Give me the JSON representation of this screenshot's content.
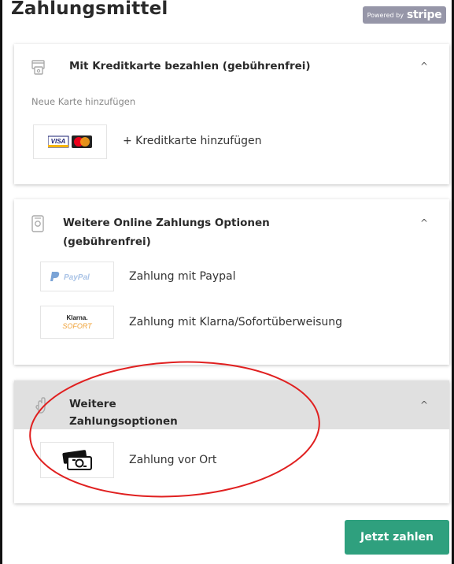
{
  "header": {
    "title": "Zahlungsmittel",
    "badge_powered": "Powered by",
    "badge_brand": "stripe"
  },
  "sections": {
    "card": {
      "title": "Mit Kreditkarte bezahlen (gebührenfrei)",
      "icon": "credit-card-icon",
      "subtitle": "Neue Karte hinzufügen",
      "logo_visa": "VISA",
      "add_label": "+ Kreditkarte hinzufügen",
      "chevron": "^"
    },
    "online": {
      "title_line1": "Weitere Online Zahlungs Optionen",
      "title_line2": "(gebührenfrei)",
      "icon": "wallet-icon",
      "chevron": "^",
      "options": [
        {
          "logo": "PayPal",
          "label": "Zahlung mit Paypal"
        },
        {
          "logo_top": "Klarna.",
          "logo_bottom": "SOFORT",
          "label": "Zahlung mit Klarna/Sofortüberweisung"
        }
      ]
    },
    "other": {
      "title_line1": "Weitere",
      "title_line2": "Zahlungsoptionen",
      "icon": "hand-icon",
      "chevron": "^",
      "options": [
        {
          "icon": "cash-icon",
          "label": "Zahlung vor Ort"
        }
      ]
    }
  },
  "actions": {
    "pay_label": "Jetzt zahlen"
  },
  "colors": {
    "primary_button": "#2fa07e",
    "annotation": "#e02020",
    "stripe_badge": "#9696a8"
  }
}
